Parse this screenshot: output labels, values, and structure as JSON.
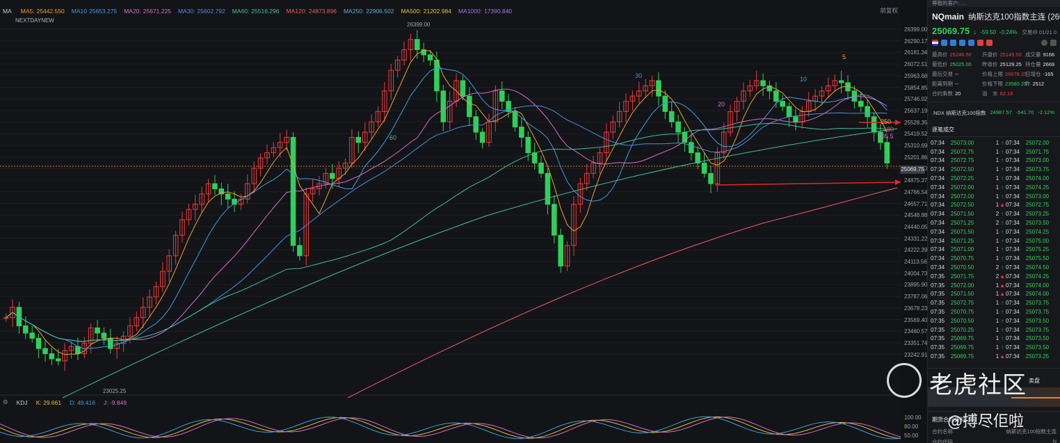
{
  "ma_bar": {
    "items": [
      {
        "label": "MA",
        "value": "",
        "color": "#c9ccd2"
      },
      {
        "label": "MA5:",
        "value": "25442.550",
        "color": "#f0a030"
      },
      {
        "label": "MA10",
        "value": "25653.275",
        "color": "#3aa0e8"
      },
      {
        "label": "MA20:",
        "value": "25671.225",
        "color": "#d070d0"
      },
      {
        "label": "MA30:",
        "value": "25602.792",
        "color": "#4a8fe0"
      },
      {
        "label": "MA60:",
        "value": "25516.296",
        "color": "#3cc0a0"
      },
      {
        "label": "MA120:",
        "value": "24873.896",
        "color": "#e86060"
      },
      {
        "label": "MA250:",
        "value": "22906.502",
        "color": "#5ab0e0"
      },
      {
        "label": "MA500:",
        "value": "21202.984",
        "color": "#e8c030"
      },
      {
        "label": "MA1000:",
        "value": "17390.840",
        "color": "#b070f0"
      }
    ],
    "right_button": "前复权"
  },
  "sub_tag": "NEXTDAYNEW",
  "kdj": {
    "name": "KDJ",
    "k_label": "K:",
    "k_value": "29.661",
    "d_label": "D:",
    "d_value": "49.416",
    "j_label": "J:",
    "j_value": "-9.849"
  },
  "y_axis_labels": [
    "26399.00",
    "26290.17",
    "26181.34",
    "26072.51",
    "25963.68",
    "25854.85",
    "25746.02",
    "25637.19",
    "25528.35",
    "25419.52",
    "25310.69",
    "25201.86",
    "24984.20",
    "24875.37",
    "24766.54",
    "24657.71",
    "24548.88",
    "24440.05",
    "24331.22",
    "24222.39",
    "24113.56",
    "24004.73",
    "23895.90",
    "23787.06",
    "23678.23",
    "23569.40",
    "23460.57",
    "23351.74",
    "23242.91"
  ],
  "kdj_axis_labels": [
    "100.00",
    "80.00",
    "50.00"
  ],
  "current_price_tag": "25069.75",
  "annotations": {
    "high_label": "26399.00",
    "low_label": "23025.25",
    "ma_60": "60",
    "ma_30": "30",
    "ma_20": "20",
    "ma_10": "10",
    "ma_5": "5",
    "ma_250_right": "250",
    "ma_120_right": "120",
    "ma_180_right": "180",
    "value_305": "305.5"
  },
  "panel": {
    "top_bar": "尊敬的客户: ...",
    "code": "NQmain",
    "name": "纳斯达克100指数主连 (260",
    "price": "25069.75",
    "arrow": "↓",
    "change": "-59.50",
    "change_pct": "-0.24%",
    "time": "交易中 01/21 0",
    "stats": [
      [
        "最高价",
        "25246.50",
        "red",
        "开盘价",
        "25149.50",
        "red",
        "成交量",
        "9166",
        "white"
      ],
      [
        "最低价",
        "25025.00",
        "green",
        "昨收价",
        "25129.25",
        "white",
        "持仓量",
        "2669",
        "white"
      ],
      [
        "最后交易",
        "--",
        "white",
        "价格上限",
        "26678.25",
        "red",
        "日增仓",
        "-165",
        "white"
      ],
      [
        "距离到期",
        "--",
        "white",
        "价格下限",
        "23580.25",
        "green",
        "昨",
        "2512",
        "white"
      ],
      [
        "合约乘数",
        "20",
        "white",
        "溢　水",
        "82.18",
        "red",
        "",
        "",
        "white"
      ]
    ],
    "ndx": {
      "name": ".NDX 纳斯达克100指数",
      "price": "24987.57",
      "change": "-541.70",
      "pct": "-2.12%"
    },
    "trades_title": "逐笔成交",
    "trades": [
      [
        "07:34",
        "25073.00",
        "1",
        "up",
        "07:34",
        "25072.00"
      ],
      [
        "07:34",
        "25072.75",
        "1",
        "up",
        "07:34",
        "25071.75"
      ],
      [
        "07:34",
        "25072.75",
        "1",
        "up",
        "07:34",
        "25073.00"
      ],
      [
        "07:34",
        "25072.50",
        "1",
        "up",
        "07:34",
        "25073.75"
      ],
      [
        "07:34",
        "25072.25",
        "1",
        "up",
        "07:34",
        "25074.00"
      ],
      [
        "07:34",
        "25072.00",
        "1",
        "up",
        "07:34",
        "25074.25"
      ],
      [
        "07:34",
        "25072.00",
        "1",
        "up",
        "07:34",
        "25073.00"
      ],
      [
        "07:34",
        "25072.50",
        "1",
        "dn",
        "07:34",
        "25072.75"
      ],
      [
        "07:34",
        "25071.50",
        "2",
        "up",
        "07:34",
        "25073.25"
      ],
      [
        "07:34",
        "25071.25",
        "2",
        "up",
        "07:34",
        "25073.50"
      ],
      [
        "07:34",
        "25071.50",
        "1",
        "up",
        "07:34",
        "25074.25"
      ],
      [
        "07:34",
        "25071.25",
        "1",
        "up",
        "07:34",
        "25075.00"
      ],
      [
        "07:34",
        "25071.00",
        "1",
        "up",
        "07:34",
        "25075.25"
      ],
      [
        "07:34",
        "25070.75",
        "1",
        "up",
        "07:34",
        "25075.50"
      ],
      [
        "07:34",
        "25070.50",
        "2",
        "up",
        "07:34",
        "25074.50"
      ],
      [
        "07:35",
        "25071.75",
        "2",
        "dn",
        "07:34",
        "25074.25"
      ],
      [
        "07:35",
        "25072.00",
        "1",
        "dn",
        "07:34",
        "25074.00"
      ],
      [
        "07:35",
        "25071.50",
        "1",
        "dn",
        "07:34",
        "25074.00"
      ],
      [
        "07:35",
        "25072.75",
        "1",
        "up",
        "07:34",
        "25073.75"
      ],
      [
        "07:35",
        "25070.75",
        "1",
        "up",
        "07:34",
        "25073.75"
      ],
      [
        "07:35",
        "25070.50",
        "1",
        "up",
        "07:34",
        "25073.50"
      ],
      [
        "07:35",
        "25070.25",
        "1",
        "up",
        "07:34",
        "25073.75"
      ],
      [
        "07:35",
        "25069.75",
        "1",
        "up",
        "07:34",
        "25073.50"
      ],
      [
        "07:35",
        "25069.75",
        "1",
        "up",
        "07:34",
        "25073.50"
      ],
      [
        "07:35",
        "25069.75",
        "1",
        "dn",
        "07:34",
        "25073.25"
      ]
    ],
    "orderbook_title_left": "买盘",
    "orderbook_title_right": "卖盘",
    "ob_sub_left": "买盘",
    "ob_sub_right": "卖盘",
    "info_title": "期货合约资料",
    "info_rows": [
      [
        "合约名称",
        "纳斯达克100指数主连"
      ],
      [
        "合约代码",
        "N"
      ],
      [
        "标的",
        "纳斯达克"
      ]
    ]
  },
  "watermark": {
    "brand": "老虎社区",
    "author": "@搏尽佢啦"
  },
  "colors": {
    "up": "#ef3b3b",
    "down": "#2fd05a",
    "bg": "#131417",
    "arrow": "#e02a2a"
  }
}
